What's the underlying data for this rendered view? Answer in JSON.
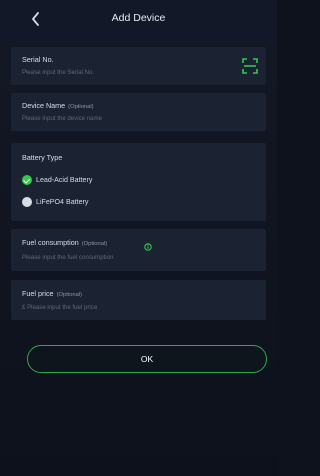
{
  "header": {
    "title": "Add Device",
    "back_icon": "chevron-left-icon"
  },
  "serial": {
    "label": "Serial No.",
    "placeholder": "Please input the Serial No.",
    "scan_icon": "scan-icon"
  },
  "device_name": {
    "label": "Device Name",
    "optional": "(Optional)",
    "placeholder": "Please input the device name"
  },
  "battery": {
    "label": "Battery Type",
    "options": [
      {
        "label": "Lead-Acid Battery",
        "selected": true
      },
      {
        "label": "LiFePO4 Battery",
        "selected": false
      }
    ]
  },
  "fuel_consumption": {
    "label": "Fuel consumption",
    "optional": "(Optional)",
    "placeholder": "Please input the fuel consumption",
    "info_icon": "info-icon"
  },
  "fuel_price": {
    "label": "Fuel price",
    "optional": "(Optional)",
    "placeholder": "£ Please input the fuel price"
  },
  "ok_button": {
    "label": "OK"
  },
  "colors": {
    "accent": "#33c94a",
    "background": "#0e121c",
    "panel": "#1b2232"
  }
}
